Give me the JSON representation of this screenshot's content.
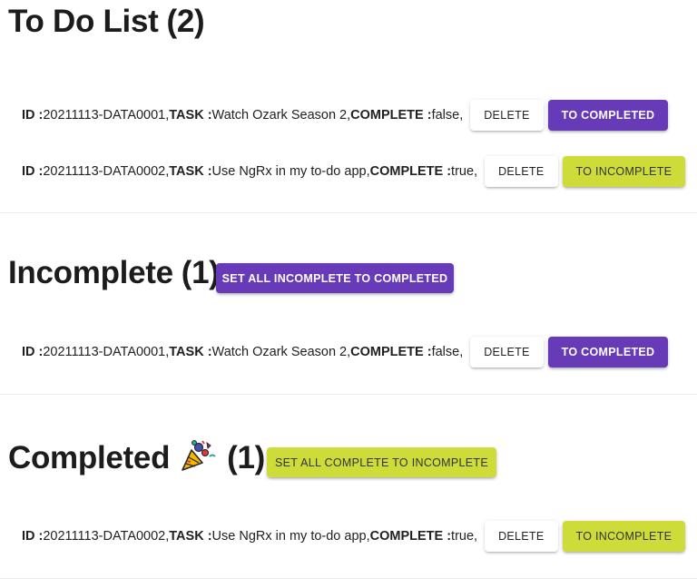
{
  "todo": {
    "title": "To Do List",
    "count": "(2)",
    "items": [
      {
        "id_label": "ID :",
        "id": "20211113-DATA0001,",
        "task_label": "TASK :",
        "task": "Watch Ozark Season 2,",
        "complete_label": "COMPLETE :",
        "complete": "false,",
        "delete_label": "DELETE",
        "toggle_label": "TO COMPLETED"
      },
      {
        "id_label": "ID :",
        "id": "20211113-DATA0002,",
        "task_label": "TASK :",
        "task": "Use NgRx in my to-do app,",
        "complete_label": "COMPLETE :",
        "complete": "true,",
        "delete_label": "DELETE",
        "toggle_label": "TO INCOMPLETE"
      }
    ]
  },
  "incomplete": {
    "title": "Incomplete",
    "count": "(1)",
    "set_all_label": "SET ALL INCOMPLETE TO COMPLETED",
    "items": [
      {
        "id_label": "ID :",
        "id": "20211113-DATA0001,",
        "task_label": "TASK :",
        "task": "Watch Ozark Season 2,",
        "complete_label": "COMPLETE :",
        "complete": "false,",
        "delete_label": "DELETE",
        "toggle_label": "TO COMPLETED"
      }
    ]
  },
  "completed": {
    "title": "Completed",
    "emoji_icon": "party-popper-icon",
    "count": "(1)",
    "set_all_label": "SET ALL COMPLETE TO INCOMPLETE",
    "items": [
      {
        "id_label": "ID :",
        "id": "20211113-DATA0002,",
        "task_label": "TASK :",
        "task": "Use NgRx in my to-do app,",
        "complete_label": "COMPLETE :",
        "complete": "true,",
        "delete_label": "DELETE",
        "toggle_label": "TO INCOMPLETE"
      }
    ]
  },
  "colors": {
    "primary": "#673ab7",
    "accent": "#cddc39",
    "divider": "#ececec"
  }
}
